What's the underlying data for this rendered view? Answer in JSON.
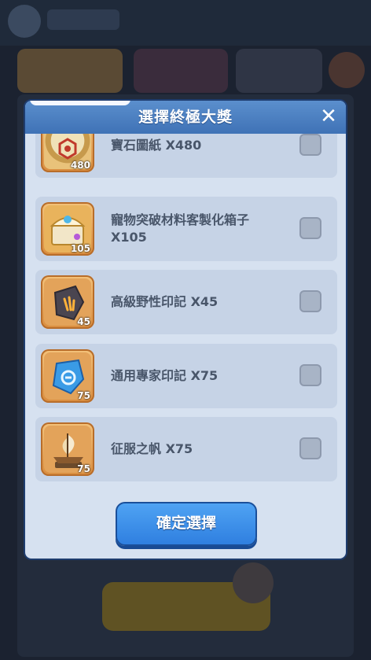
{
  "modal": {
    "title": "選擇終極大獎",
    "close_label": "✕",
    "confirm_label": "確定選擇"
  },
  "items": [
    {
      "name": "寶石圖紙 X480",
      "qty": "480",
      "checked": false,
      "icon": "gem-blueprint-scroll"
    },
    {
      "name": "寵物突破材料客製化箱子 X105",
      "qty": "105",
      "checked": false,
      "icon": "treasure-chest"
    },
    {
      "name": "高級野性印記 X45",
      "qty": "45",
      "checked": false,
      "icon": "wild-mark-stone"
    },
    {
      "name": "通用專家印記 X75",
      "qty": "75",
      "checked": false,
      "icon": "expert-mark-crystal"
    },
    {
      "name": "征服之帆 X75",
      "qty": "75",
      "checked": false,
      "icon": "conquest-sail-ship"
    }
  ],
  "colors": {
    "header": "#4a80c2",
    "modal_bg": "#d6e1f0",
    "confirm": "#3d8fea"
  }
}
